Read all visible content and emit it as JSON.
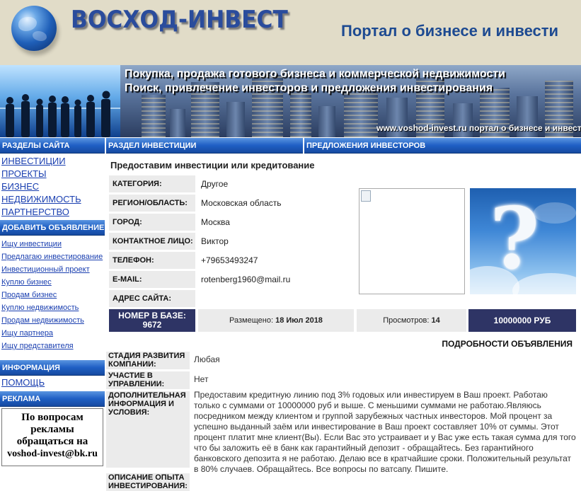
{
  "header": {
    "logo_text": "ВОСХОД-ИНВЕСТ",
    "portal_title": "Портал о бизнесе и инвести"
  },
  "banner": {
    "line1": "Покупка, продажа готового бизнеса и коммерческой недвижимости",
    "line2": "Поиск, привлечение инвесторов и предложения инвестирования",
    "url": "www.voshod-invest.ru портал о бизнесе и инвест"
  },
  "sidebar": {
    "sections_title": "РАЗДЕЛЫ САЙТА",
    "sections": [
      "ИНВЕСТИЦИИ",
      "ПРОЕКТЫ",
      "БИЗНЕС",
      "НЕДВИЖИМОСТЬ",
      "ПАРТНЕРСТВО"
    ],
    "add_title": "ДОБАВИТЬ ОБЪЯВЛЕНИЕ",
    "add_links": [
      "Ищу инвестиции",
      "Предлагаю инвестирование",
      "Инвестиционный проект",
      "Куплю бизнес",
      "Продам бизнес",
      "Куплю недвижимость",
      "Продам недвижимость",
      "Ищу партнера",
      "Ищу представителя"
    ],
    "info_title": "ИНФОРМАЦИЯ",
    "help_link": "ПОМОЩЬ",
    "ads_title": "РЕКЛАМА",
    "ad_lines": [
      "По вопросам",
      "рекламы",
      "обращаться на",
      "voshod-invest@bk.ru"
    ]
  },
  "tabs": {
    "section": "РАЗДЕЛ ИНВЕСТИЦИИ",
    "offers": "ПРЕДЛОЖЕНИЯ ИНВЕСТОРОВ"
  },
  "ad": {
    "title": "Предоставим инвестиции или кредитование",
    "fields": [
      {
        "label": "КАТЕГОРИЯ:",
        "value": "Другое"
      },
      {
        "label": "РЕГИОН/ОБЛАСТЬ:",
        "value": "Московская область"
      },
      {
        "label": "ГОРОД:",
        "value": "Москва"
      },
      {
        "label": "КОНТАКТНОЕ ЛИЦО:",
        "value": "Виктор"
      },
      {
        "label": "ТЕЛЕФОН:",
        "value": "+79653493247"
      },
      {
        "label": "E-MAIL:",
        "value": "rotenberg1960@mail.ru"
      },
      {
        "label": "АДРЕС САЙТА:",
        "value": ""
      }
    ],
    "stats": {
      "number_label": "НОМЕР В БАЗЕ:",
      "number_value": "9672",
      "posted_label": "Размещено:",
      "posted_value": "18 Июл 2018",
      "views_label": "Просмотров:",
      "views_value": "14",
      "price": "10000000 РУБ"
    },
    "details_title": "ПОДРОБНОСТИ ОБЪЯВЛЕНИЯ",
    "details": [
      {
        "label": "СТАДИЯ РАЗВИТИЯ КОМПАНИИ:",
        "value": "Любая"
      },
      {
        "label": "УЧАСТИЕ В УПРАВЛЕНИИ:",
        "value": "Нет"
      },
      {
        "label": "ДОПОЛНИТЕЛЬНАЯ ИНФОРМАЦИЯ И УСЛОВИЯ:",
        "value": "Предоставим кредитную линию под 3% годовых или инвестируем в Ваш проект. Работаю только с суммами от 10000000 руб и выше. С меньшими суммами не работаю.Являюсь посредником между клиентом и группой зарубежных частных инвесторов. Мой процент за успешно выданный заём или инвестирование в Ваш проект составляет 10% от суммы. Этот процент платит мне клиент(Вы). Если Вас это устраивает и у Вас уже есть такая сумма для того что бы заложить её в банк как гарантийный депозит - обращайтесь. Без гарантийного банковского депозита я не работаю. Делаю все в кратчайшие сроки. Положительный результат в 80% случаев. Обращайтесь. Все вопросы по ватсапу. Пишите."
      },
      {
        "label": "ОПИСАНИЕ ОПЫТА ИНВЕСТИРОВАНИЯ:",
        "value": ""
      }
    ]
  }
}
